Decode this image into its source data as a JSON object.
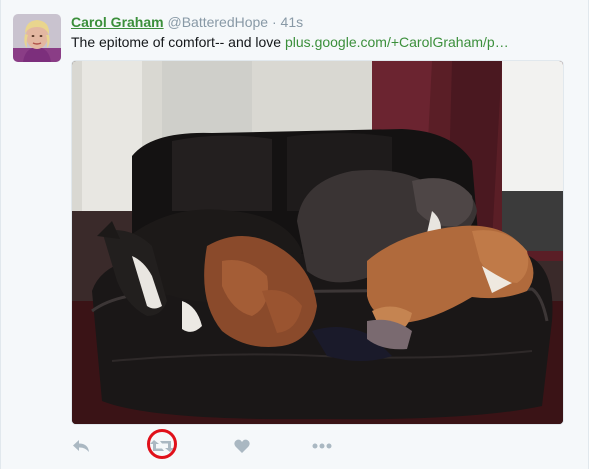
{
  "tweet": {
    "fullname": "Carol Graham",
    "handle": "@BatteredHope",
    "separator": "·",
    "timestamp": "41s",
    "text": "The epitome of comfort-- and love ",
    "link_text": "plus.google.com/+CarolGraham/p…"
  },
  "actions": {
    "reply_icon": "reply-icon",
    "retweet_icon": "retweet-icon",
    "like_icon": "heart-icon",
    "more_icon": "more-dots-icon",
    "retweet_highlight_color": "#e0101a"
  },
  "colors": {
    "name_link": "#3b8f3b",
    "muted": "#8899a6",
    "icon_gray": "#aab8c2",
    "background": "#f5f8fa"
  }
}
